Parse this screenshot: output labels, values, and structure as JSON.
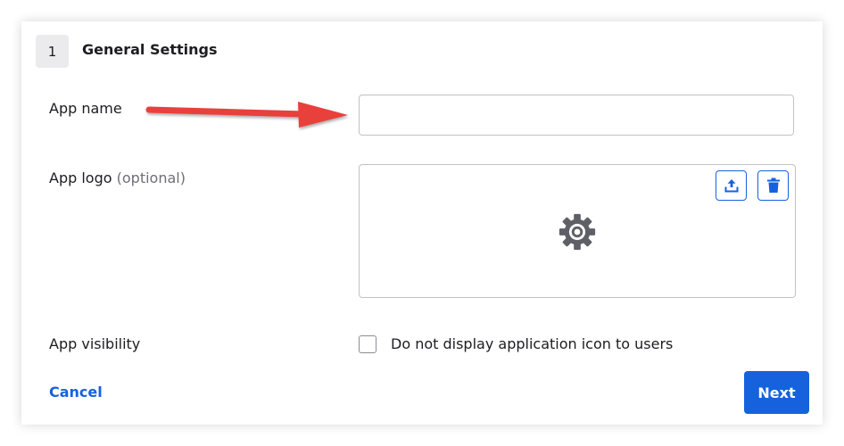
{
  "section": {
    "step_number": "1",
    "title": "General Settings"
  },
  "fields": {
    "app_name": {
      "label": "App name",
      "value": "",
      "placeholder": ""
    },
    "app_logo": {
      "label": "App logo",
      "optional": "(optional)",
      "upload_icon": "upload-icon",
      "delete_icon": "trash-icon",
      "placeholder_icon": "gear-icon"
    },
    "app_visibility": {
      "label": "App visibility",
      "checkbox_label": "Do not display application icon to users",
      "checked": false
    }
  },
  "actions": {
    "cancel_label": "Cancel",
    "next_label": "Next"
  },
  "colors": {
    "accent": "#1662dd",
    "annotation_arrow": "#e8413b",
    "gear": "#5f5f66"
  }
}
